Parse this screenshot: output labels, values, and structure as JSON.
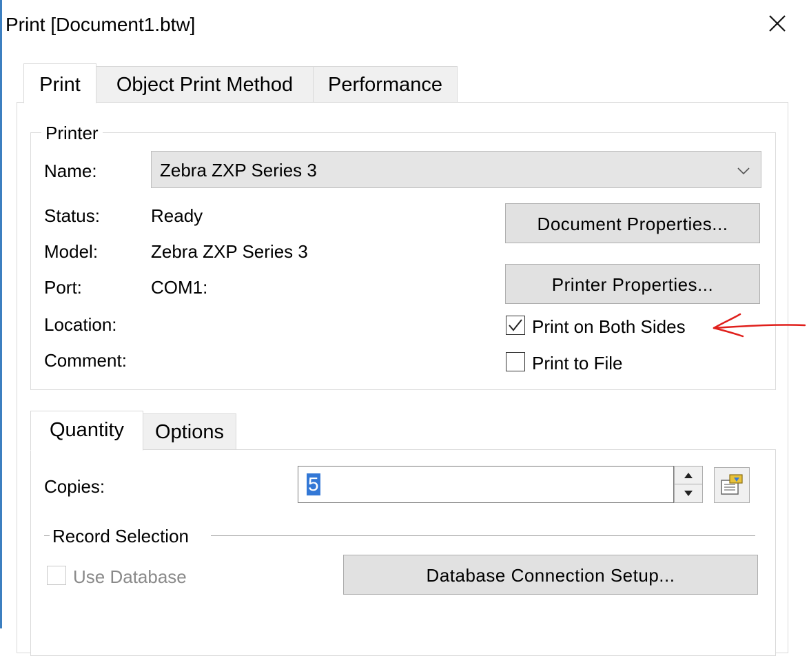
{
  "window": {
    "title": "Print [Document1.btw]"
  },
  "tabs": [
    {
      "label": "Print",
      "active": true
    },
    {
      "label": "Object Print Method",
      "active": false
    },
    {
      "label": "Performance",
      "active": false
    }
  ],
  "printer": {
    "group_label": "Printer",
    "name_label": "Name:",
    "name_value": "Zebra ZXP Series 3",
    "status_label": "Status:",
    "status_value": "Ready",
    "model_label": "Model:",
    "model_value": "Zebra ZXP Series 3",
    "port_label": "Port:",
    "port_value": "COM1:",
    "location_label": "Location:",
    "comment_label": "Comment:",
    "document_properties_label": "Document Properties...",
    "printer_properties_label": "Printer Properties...",
    "print_both_sides_label": "Print on Both Sides",
    "print_both_sides_checked": true,
    "print_to_file_label": "Print to File",
    "print_to_file_checked": false
  },
  "lower_tabs": [
    {
      "label": "Quantity",
      "active": true
    },
    {
      "label": "Options",
      "active": false
    }
  ],
  "quantity": {
    "copies_label": "Copies:",
    "copies_value": "5",
    "record_selection_label": "Record Selection",
    "use_database_label": "Use Database",
    "use_database_checked": false,
    "use_database_enabled": false,
    "database_setup_label": "Database Connection Setup..."
  },
  "annotation": {
    "arrow_color": "#e0201c"
  },
  "icons": {
    "close": "close-icon",
    "dropdown": "chevron-down-icon",
    "check": "check-icon",
    "spin_up": "spin-up-icon",
    "spin_down": "spin-down-icon",
    "data_source": "data-source-icon"
  }
}
